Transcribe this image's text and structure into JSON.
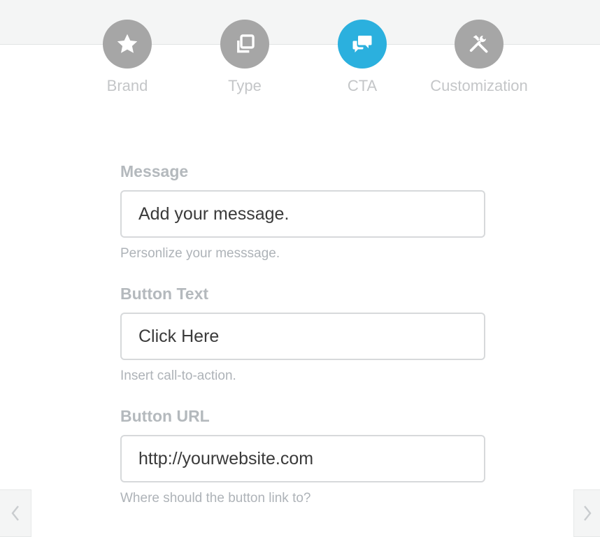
{
  "steps": [
    {
      "label": "Brand",
      "icon": "star-icon",
      "active": false
    },
    {
      "label": "Type",
      "icon": "copy-icon",
      "active": false
    },
    {
      "label": "CTA",
      "icon": "chat-icon",
      "active": true
    },
    {
      "label": "Customization",
      "icon": "tools-icon",
      "active": false
    }
  ],
  "form": {
    "message": {
      "label": "Message",
      "value": "Add your message.",
      "help": "Personlize your messsage."
    },
    "button_text": {
      "label": "Button Text",
      "value": "Click Here",
      "help": "Insert call-to-action."
    },
    "button_url": {
      "label": "Button URL",
      "value": "http://yourwebsite.com",
      "help": "Where should the button link to?"
    }
  },
  "colors": {
    "active_step": "#2bb0de",
    "inactive_step": "#a6a6a6",
    "label": "#b4b9bd",
    "help": "#aeb3b8"
  },
  "nav": {
    "prev_icon": "chevron-left-icon",
    "next_icon": "chevron-right-icon"
  }
}
